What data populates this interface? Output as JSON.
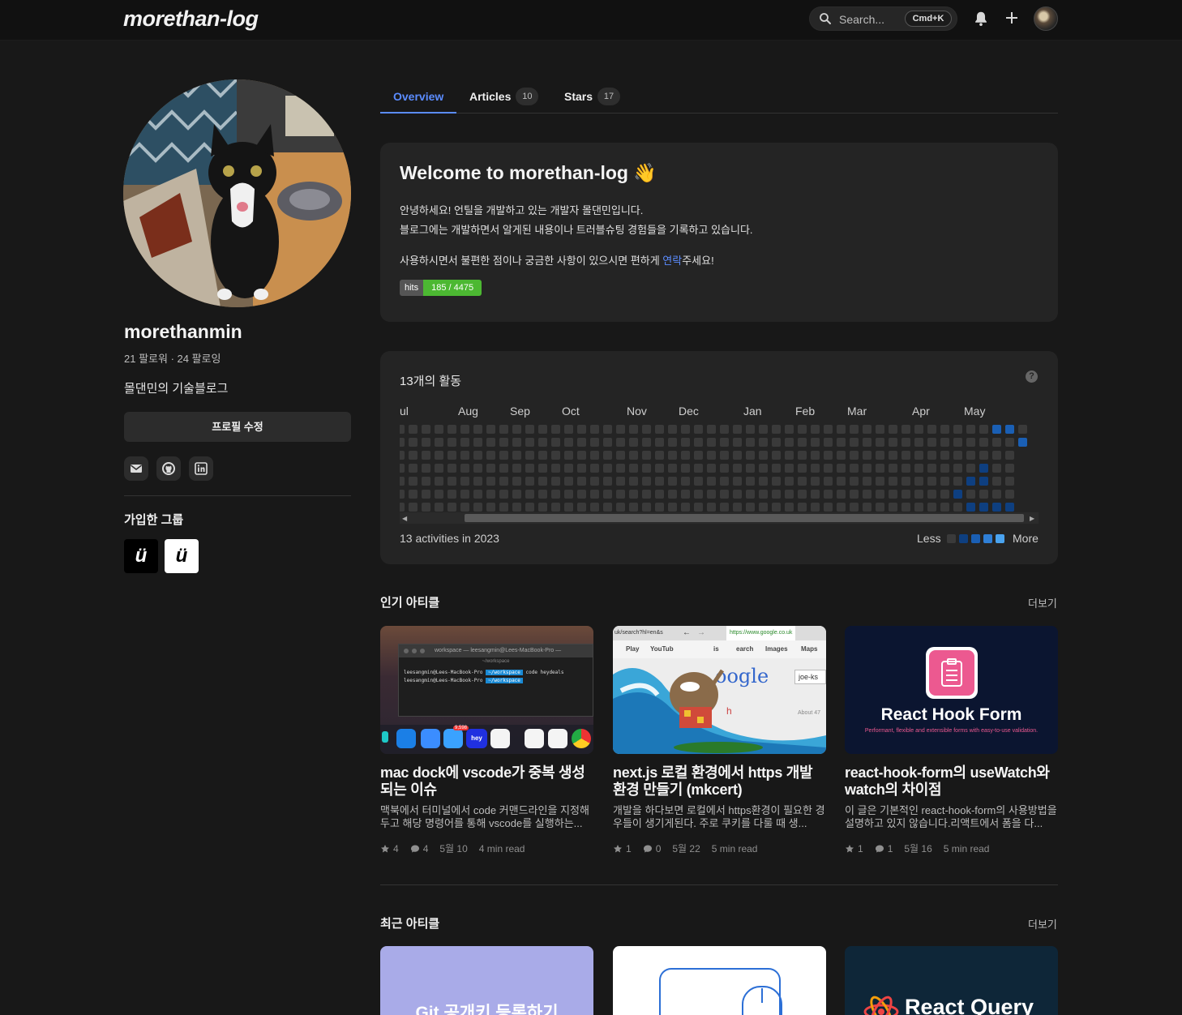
{
  "header": {
    "logo": "morethan-log",
    "search_placeholder": "Search...",
    "search_shortcut": "Cmd+K"
  },
  "profile": {
    "username": "morethanmin",
    "follow_stats": "21 팔로워 · 24 팔로잉",
    "bio": "몰댄민의 기술블로그",
    "edit_button": "프로필 수정",
    "groups_title": "가입한 그룹",
    "groups": [
      "ü",
      "ü"
    ]
  },
  "tabs": [
    {
      "label": "Overview"
    },
    {
      "label": "Articles",
      "count": "10"
    },
    {
      "label": "Stars",
      "count": "17"
    }
  ],
  "welcome": {
    "title": "Welcome to morethan-log 👋",
    "line1": "안녕하세요! 언틸을 개발하고 있는 개발자 몰댄민입니다.",
    "line2": "블로그에는 개발하면서 알게된 내용이나 트러블슈팅 경험들을 기록하고 있습니다.",
    "line3_pre": "사용하시면서 불편한 점이나 궁금한 사항이 있으시면 편하게 ",
    "line3_link": "연락",
    "line3_post": "주세요!",
    "hits_label": "hits",
    "hits_value": "185 / 4475"
  },
  "activity": {
    "title": "13개의 활동",
    "help": "?",
    "months": [
      "ul",
      "Aug",
      "Sep",
      "Oct",
      "Nov",
      "Dec",
      "Jan",
      "Feb",
      "Mar",
      "Apr",
      "May"
    ],
    "footer": "13 activities in 2023",
    "legend_less": "Less",
    "legend_more": "More",
    "colors": {
      "empty": "#3a3a3a",
      "level1": "#0e3f80",
      "level2": "#1a5fb4",
      "level3": "#2f7fd6",
      "level4": "#4aa3ef"
    }
  },
  "popular": {
    "title": "인기 아티클",
    "more": "더보기",
    "articles": [
      {
        "title": "mac dock에 vscode가 중복 생성되는 이슈",
        "desc": "맥북에서 터미널에서 code 커맨드라인을 지정해두고 해당 명령어를 통해 vscode를 실행하는...",
        "stars": "4",
        "comments": "4",
        "date": "5월 10",
        "read": "4 min read",
        "thumb_title": "workspace — leesangmin@Lees-MacBook-Pro —",
        "thumb_sub": "~/workspace",
        "thumb_line1": "leesangmin@Lees-MacBook-Pro",
        "thumb_line2": "leesangmin@Lees-MacBook-Pro",
        "thumb_path": "~/workspace",
        "thumb_cmd": "code heydeals",
        "thumb_badge": "9,598",
        "thumb_hey": "hey"
      },
      {
        "title": "next.js 로컬 환경에서 https 개발 환경 만들기 (mkcert)",
        "desc": "개발을 하다보면 로컬에서 https환경이 필요한 경우들이 생기게된다. 주로 쿠키를 다룰 때 생...",
        "stars": "1",
        "comments": "0",
        "date": "5월 22",
        "read": "5 min read",
        "thumb_url": "https://www.google.co.uk",
        "thumb_url_left": "uk/search?hl=en&s",
        "thumb_menu": [
          "Play",
          "YouTub",
          "is",
          "earch",
          "Images",
          "Maps"
        ],
        "thumb_logo": "oogle",
        "thumb_input": "joe-ks",
        "thumb_h": "h",
        "thumb_about": "About 47"
      },
      {
        "title": "react-hook-form의 useWatch와 watch의 차이점",
        "desc": "이 글은 기본적인 react-hook-form의 사용방법을 설명하고 있지 않습니다.리액트에서 폼을 다...",
        "stars": "1",
        "comments": "1",
        "date": "5월 16",
        "read": "5 min read",
        "thumb_title": "React Hook Form",
        "thumb_sub": "Performant, flexible and extensible forms with easy-to-use validation."
      }
    ]
  },
  "recent": {
    "title": "최근 아티클",
    "more": "더보기",
    "thumbs": [
      {
        "text": "Git 공개키 등록하기"
      },
      {
        "text": ""
      },
      {
        "text": "React Query"
      }
    ]
  }
}
